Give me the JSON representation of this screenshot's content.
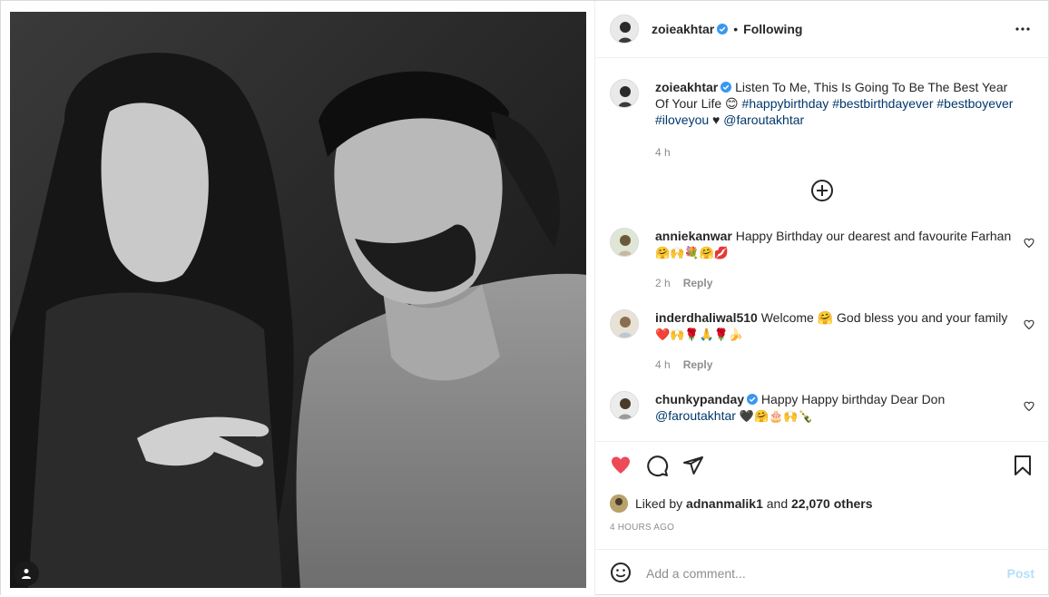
{
  "post": {
    "author": "zoieakhtar",
    "follow_status": "Following",
    "separator": "•"
  },
  "caption": {
    "username": "zoieakhtar",
    "text": "Listen To Me, This Is Going To Be The Best Year Of Your Life 😊",
    "hashtags": [
      "#happybirthday",
      "#bestbirthdayever",
      "#bestboyever",
      "#iloveyou"
    ],
    "heart": "♥",
    "mention": "@faroutakhtar",
    "age": "4 h"
  },
  "comments": [
    {
      "username": "anniekanwar",
      "text": "Happy Birthday our dearest and favourite Farhan",
      "emojis": "🤗🙌💐🤗💋",
      "age": "2 h",
      "reply_label": "Reply"
    },
    {
      "username": "inderdhaliwal510",
      "text": "Welcome 🤗 God bless you and your family",
      "emojis": "❤️🙌🌹🙏🌹🍌",
      "age": "4 h",
      "reply_label": "Reply"
    },
    {
      "username": "chunkypanday",
      "text": "Happy Happy birthday Dear Don",
      "mention": "@faroutakhtar",
      "emojis": "🖤🤗🎂🙌🍾"
    }
  ],
  "likes": {
    "prefix": "Liked by",
    "user": "adnanmalik1",
    "joiner": "and",
    "others": "22,070 others"
  },
  "timestamp": "4 HOURS AGO",
  "add_comment": {
    "placeholder": "Add a comment...",
    "post_label": "Post"
  },
  "icons": {
    "like": "heart-filled-icon",
    "comment": "comment-bubble-icon",
    "share": "paper-plane-icon",
    "save": "bookmark-icon",
    "emoji": "smiley-icon",
    "more": "ellipsis-icon",
    "load_more": "plus-circle-icon",
    "tag": "user-tag-icon"
  },
  "colors": {
    "like_red": "#ed4956",
    "verified_blue": "#3897f0",
    "hashtag_blue": "#00376b",
    "muted": "#8e8e8e",
    "post_disabled": "#b2dffc"
  }
}
